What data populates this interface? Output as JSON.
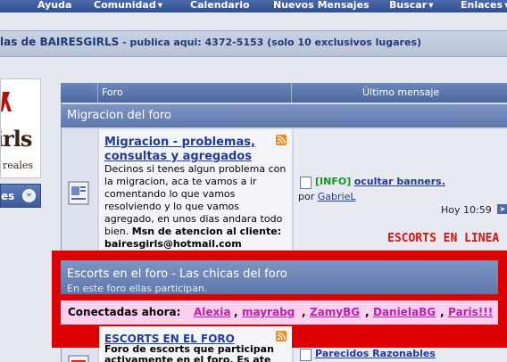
{
  "navbar": {
    "items": [
      {
        "label": "Ayuda",
        "has_menu": false
      },
      {
        "label": "Comunidad",
        "has_menu": true
      },
      {
        "label": "Calendario",
        "has_menu": false
      },
      {
        "label": "Nuevos Mensajes",
        "has_menu": false
      },
      {
        "label": "Buscar",
        "has_menu": true
      },
      {
        "label": "Enlaces",
        "has_menu": true
      }
    ]
  },
  "header": {
    "title": "las de BAIRESGIRLS",
    "subtitle": " - publica aqui: 4372-5153 (solo 10 exclusivos lugares)"
  },
  "logo": {
    "text": "irls",
    "tagline": "reales"
  },
  "sidebar": {
    "button_label": "es"
  },
  "table": {
    "col_forum": "Foro",
    "col_last_post": "Último mensaje"
  },
  "categories": [
    {
      "title": "Migracion del foro",
      "forums": [
        {
          "name": "Migracion - problemas, consultas y agregados",
          "description": "Decinos si tenes algun problema con la migracion, aca te vamos a ir comentando lo que vamos resolviendo y lo que vamos agregado, en unos dias andara todo bien.",
          "msn_label": "Msn de atencion al cliente:",
          "msn_address": "bairesgirls@hotmail.com",
          "last_post": {
            "tag": "[INFO]",
            "title": "ocultar banners.",
            "by_prefix": "por",
            "author": "GabrieL",
            "time": "Hoy 10:59"
          }
        }
      ]
    },
    {
      "title": "Escorts en el foro - Las chicas del foro",
      "subtitle": "En este foro ellas participan.",
      "online_label": "Conectadas ahora:",
      "online_users": [
        "Alexia",
        "mayrabg",
        "ZamyBG",
        "DanielaBG",
        "Paris!!!"
      ],
      "forums": [
        {
          "name": "ESCORTS EN EL FORO",
          "description": "Foro de escorts que participan activamente en el foro. Es ate",
          "last_post": {
            "title": "Parecidos Razonables"
          }
        }
      ]
    }
  ],
  "banner": {
    "text": "ESCORTS EN LINEA",
    "color": "#dd1111"
  },
  "colors": {
    "nav_bg": "#3b5998",
    "category_bg": "#6e86b8",
    "highlight_frame": "#dd0000",
    "online_row_bg": "#ffcff0",
    "online_user": "#bb22aa",
    "link": "#1f3a99"
  }
}
